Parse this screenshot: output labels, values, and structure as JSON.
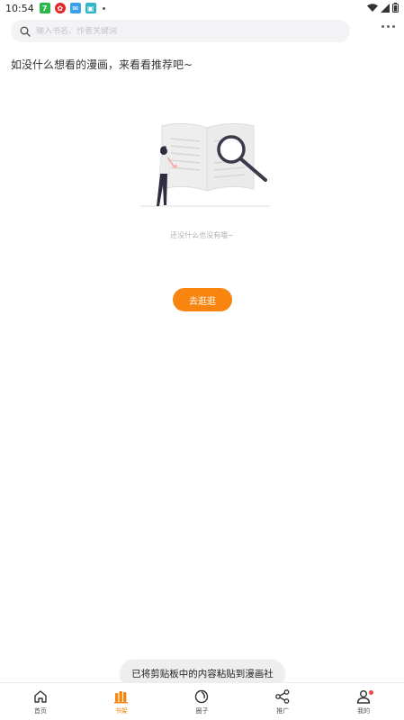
{
  "status_bar": {
    "time": "10:54",
    "notification_icons": [
      {
        "name": "app-green-icon",
        "glyph": "7",
        "color": "#2bb84a"
      },
      {
        "name": "app-red-icon",
        "glyph": "✿",
        "color": "#e02a2a"
      },
      {
        "name": "app-blue-icon",
        "glyph": "✉",
        "color": "#3aa0e8"
      },
      {
        "name": "app-teal-icon",
        "glyph": "▣",
        "color": "#2fb6c9"
      }
    ]
  },
  "search": {
    "placeholder": "输入书名、作者关键词"
  },
  "main": {
    "prompt": "如没什么想看的漫画，来看看推荐吧~",
    "empty_text": "还没什么也没有哦~",
    "go_button_label": "去逛逛"
  },
  "toast": {
    "message": "已将剪贴板中的内容粘贴到漫画社"
  },
  "bottom_nav": {
    "accent": "#f7850f",
    "items": [
      {
        "label": "首页",
        "icon": "home-icon",
        "active": false
      },
      {
        "label": "书架",
        "icon": "bookshelf-icon",
        "active": true
      },
      {
        "label": "圈子",
        "icon": "circle-icon",
        "active": false
      },
      {
        "label": "推广",
        "icon": "share-icon",
        "active": false
      },
      {
        "label": "我的",
        "icon": "profile-icon",
        "active": false
      }
    ]
  }
}
